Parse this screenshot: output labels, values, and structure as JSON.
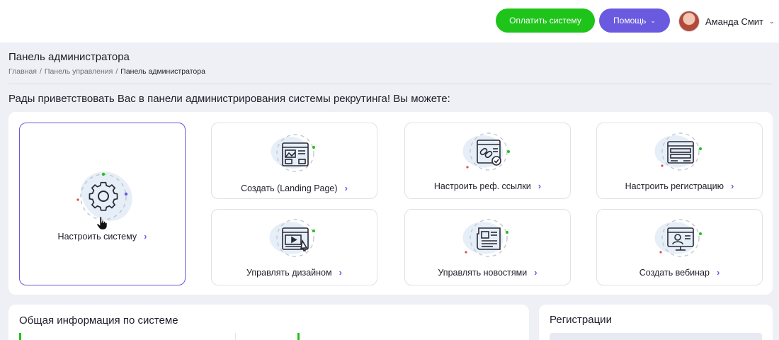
{
  "header": {
    "pay_button": "Оплатить систему",
    "help_button": "Помощь",
    "user_name": "Аманда Смит"
  },
  "page": {
    "title": "Панель администратора",
    "breadcrumb": [
      "Главная",
      "Панель управления",
      "Панель администратора"
    ],
    "breadcrumb_sep": "/",
    "welcome": "Рады приветствовать Вас в панели администрирования системы рекрутинга! Вы можете:"
  },
  "cards": [
    {
      "label": "Настроить систему",
      "icon": "gear-icon"
    },
    {
      "label": "Создать (Landing Page)",
      "icon": "landing-page-icon"
    },
    {
      "label": "Настроить реф. ссылки",
      "icon": "link-icon"
    },
    {
      "label": "Настроить регистрацию",
      "icon": "registration-form-icon"
    },
    {
      "label": "Управлять дизайном",
      "icon": "design-icon"
    },
    {
      "label": "Управлять новостями",
      "icon": "news-icon"
    },
    {
      "label": "Создать вебинар",
      "icon": "webinar-icon"
    }
  ],
  "sections": {
    "info_title": "Общая информация по системе",
    "registrations_title": "Регистрации"
  },
  "colors": {
    "accent": "#6a5ae0",
    "success": "#1ec41a"
  }
}
